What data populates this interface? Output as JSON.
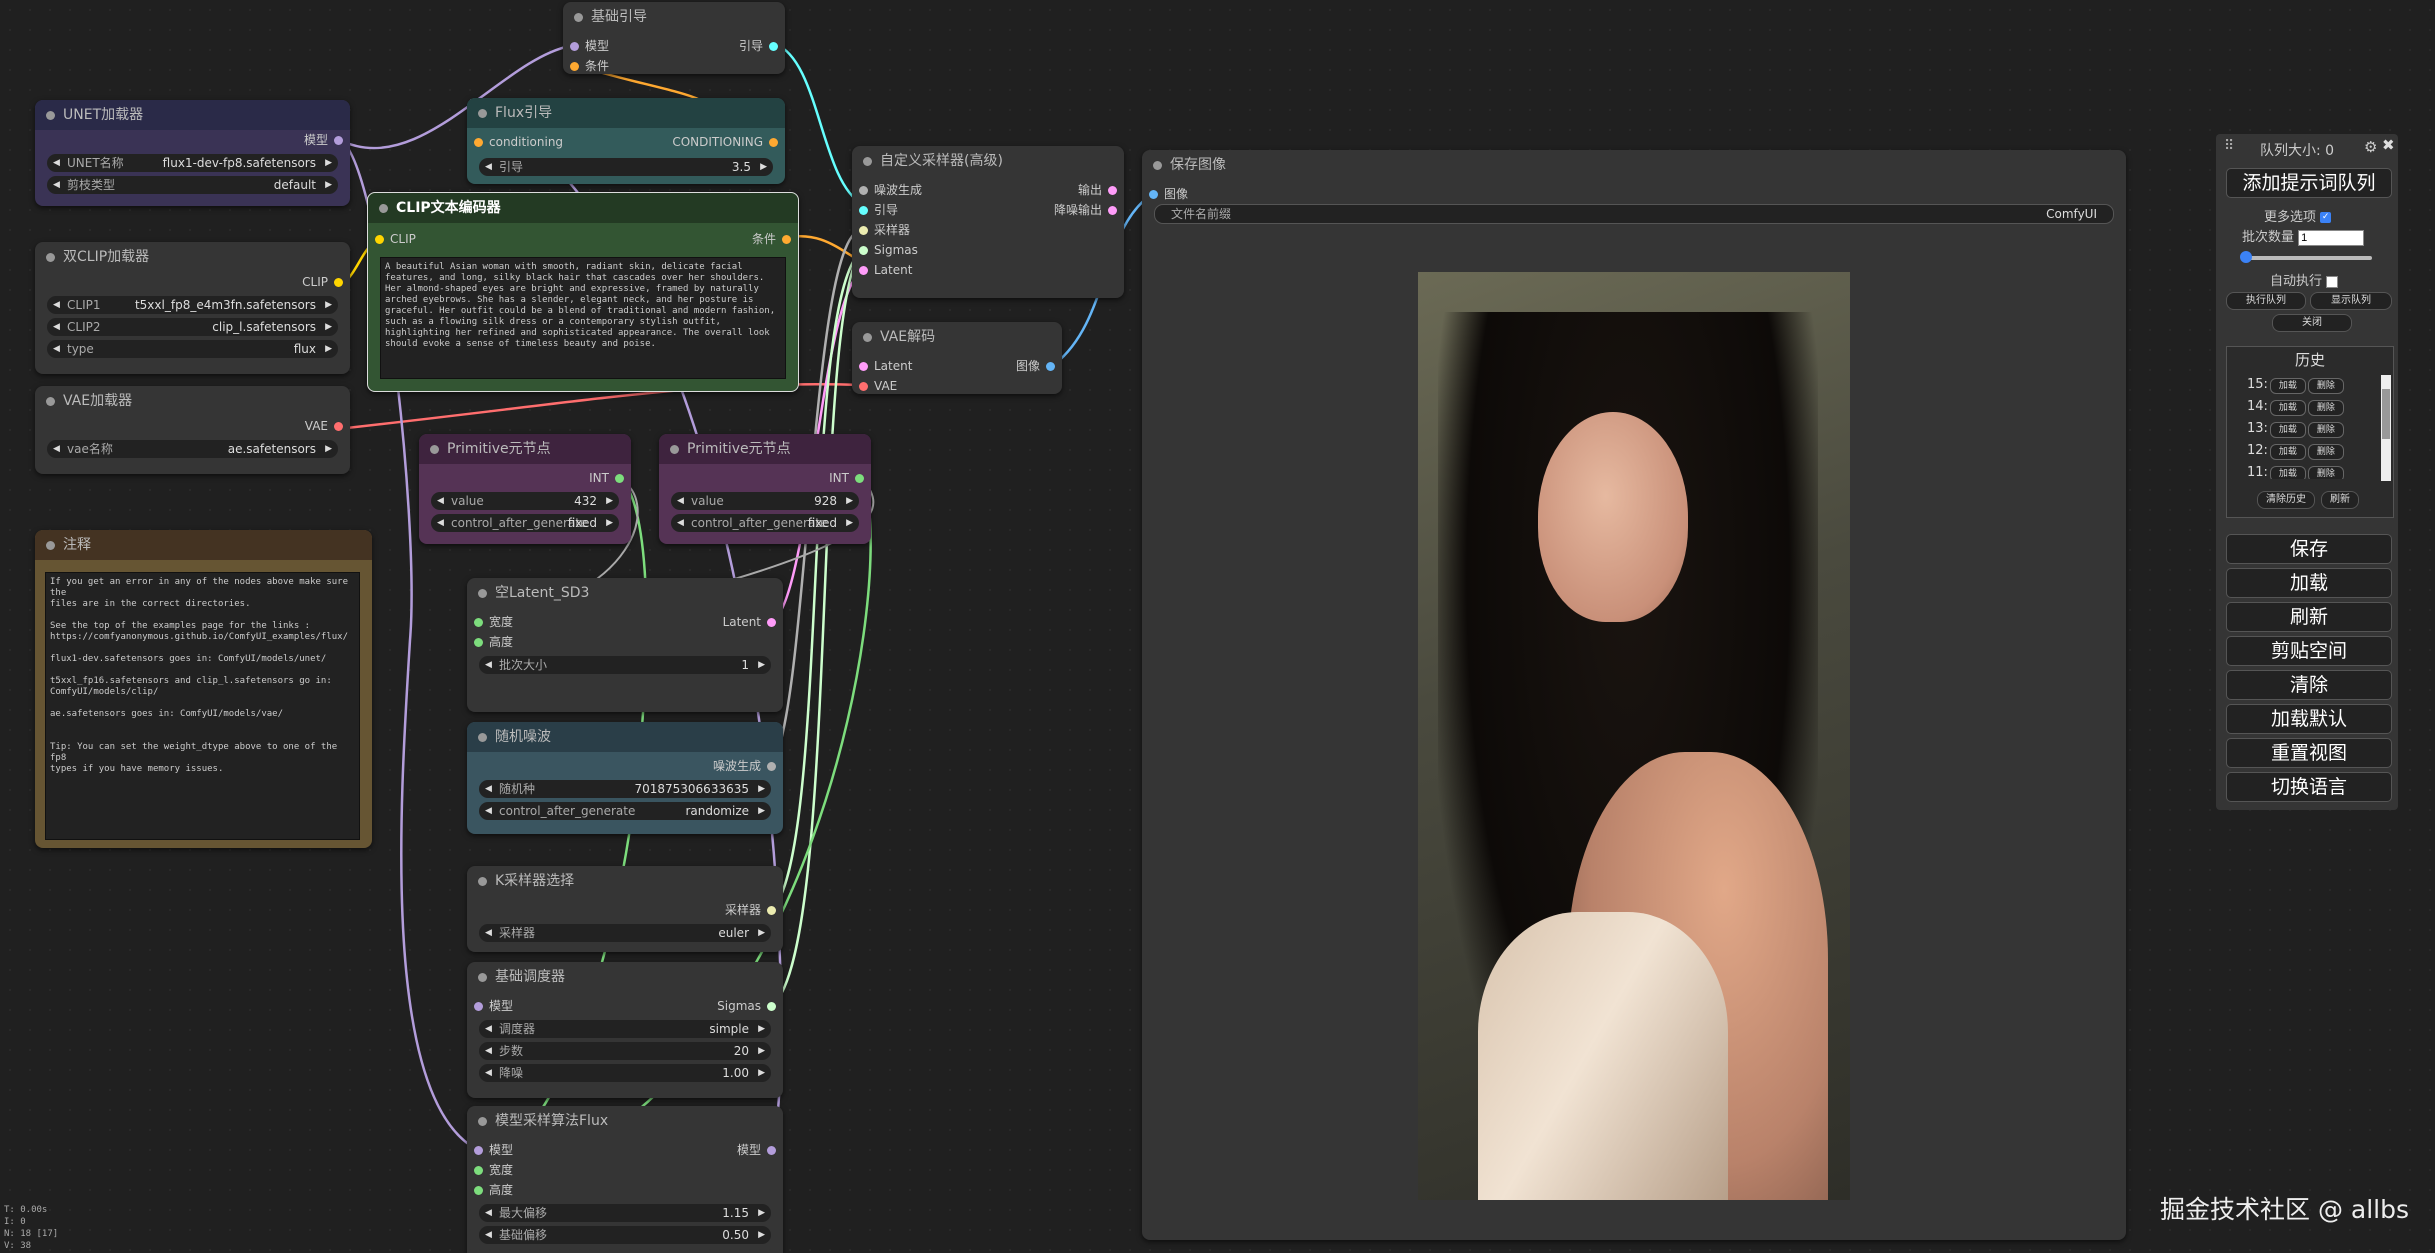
{
  "nodes": {
    "basic_guider": {
      "title": "基础引导",
      "in_model": "模型",
      "in_cond": "条件",
      "out_guider": "引导"
    },
    "unet": {
      "title": "UNET加载器",
      "out_model": "模型",
      "w1_label": "UNET名称",
      "w1_value": "flux1-dev-fp8.safetensors",
      "w2_label": "剪枝类型",
      "w2_value": "default"
    },
    "flux_guidance": {
      "title": "Flux引导",
      "in_cond": "conditioning",
      "out_cond": "CONDITIONING",
      "w_label": "引导",
      "w_value": "3.5"
    },
    "sampler_custom": {
      "title": "自定义采样器(高级)",
      "in_noise": "噪波生成",
      "in_guider": "引导",
      "in_sampler": "采样器",
      "in_sigmas": "Sigmas",
      "in_latent": "Latent",
      "out_output": "输出",
      "out_denoised": "降噪输出"
    },
    "save_image": {
      "title": "保存图像",
      "in_images": "图像",
      "w_label": "文件名前缀",
      "w_value": "ComfyUI"
    },
    "dual_clip": {
      "title": "双CLIP加载器",
      "out_clip": "CLIP",
      "w1_label": "CLIP1",
      "w1_value": "t5xxl_fp8_e4m3fn.safetensors",
      "w2_label": "CLIP2",
      "w2_value": "clip_l.safetensors",
      "w3_label": "type",
      "w3_value": "flux"
    },
    "clip_text": {
      "title": "CLIP文本编码器",
      "in_clip": "CLIP",
      "out_cond": "条件",
      "text": "A beautiful Asian woman with smooth, radiant skin, delicate facial features, and long, silky black hair that cascades over her shoulders. Her almond-shaped eyes are bright and expressive, framed by naturally arched eyebrows. She has a slender, elegant neck, and her posture is graceful. Her outfit could be a blend of traditional and modern fashion, such as a flowing silk dress or a contemporary stylish outfit, highlighting her refined and sophisticated appearance. The overall look should evoke a sense of timeless beauty and poise."
    },
    "vae_decode": {
      "title": "VAE解码",
      "in_latent": "Latent",
      "in_vae": "VAE",
      "out_image": "图像"
    },
    "vae_loader": {
      "title": "VAE加载器",
      "out_vae": "VAE",
      "w_label": "vae名称",
      "w_value": "ae.safetensors"
    },
    "prim1": {
      "title": "Primitive元节点",
      "out": "INT",
      "w1_label": "value",
      "w1_value": "432",
      "w2_label": "control_after_generate",
      "w2_value": "fixed"
    },
    "prim2": {
      "title": "Primitive元节点",
      "out": "INT",
      "w1_label": "value",
      "w1_value": "928",
      "w2_label": "control_after_generate",
      "w2_value": "fixed"
    },
    "note": {
      "title": "注释",
      "text": "If you get an error in any of the nodes above make sure the\nfiles are in the correct directories.\n\nSee the top of the examples page for the links :\nhttps://comfyanonymous.github.io/ComfyUI_examples/flux/\n\nflux1-dev.safetensors goes in: ComfyUI/models/unet/\n\nt5xxl_fp16.safetensors and clip_l.safetensors go in:\nComfyUI/models/clip/\n\nae.safetensors goes in: ComfyUI/models/vae/\n\n\nTip: You can set the weight_dtype above to one of the fp8\ntypes if you have memory issues."
    },
    "empty_latent": {
      "title": "空Latent_SD3",
      "in_width": "宽度",
      "in_height": "高度",
      "out_latent": "Latent",
      "w_label": "批次大小",
      "w_value": "1"
    },
    "random_noise": {
      "title": "随机噪波",
      "out_noise": "噪波生成",
      "w1_label": "随机种",
      "w1_value": "701875306633635",
      "w2_label": "control_after_generate",
      "w2_value": "randomize"
    },
    "ksampler_select": {
      "title": "K采样器选择",
      "out_sampler": "采样器",
      "w_label": "采样器",
      "w_value": "euler"
    },
    "basic_scheduler": {
      "title": "基础调度器",
      "in_model": "模型",
      "out_sigmas": "Sigmas",
      "w1_label": "调度器",
      "w1_value": "simple",
      "w2_label": "步数",
      "w2_value": "20",
      "w3_label": "降噪",
      "w3_value": "1.00"
    },
    "model_sampling": {
      "title": "模型采样算法Flux",
      "in_model": "模型",
      "in_width": "宽度",
      "in_height": "高度",
      "out_model": "模型",
      "w1_label": "最大偏移",
      "w1_value": "1.15",
      "w2_label": "基础偏移",
      "w2_value": "0.50"
    }
  },
  "queue_panel": {
    "queue_size": "队列大小: 0",
    "add_prompt": "添加提示词队列",
    "more_options": "更多选项",
    "batch_count_label": "批次数量",
    "batch_count_value": "1",
    "auto_exec": "自动执行",
    "exec_queue": "执行队列",
    "show_queue": "显示队列",
    "close": "关闭",
    "history_title": "历史",
    "history_items": [
      {
        "index": "15:",
        "load": "加载",
        "delete": "删除"
      },
      {
        "index": "14:",
        "load": "加载",
        "delete": "删除"
      },
      {
        "index": "13:",
        "load": "加载",
        "delete": "删除"
      },
      {
        "index": "12:",
        "load": "加载",
        "delete": "删除"
      },
      {
        "index": "11:",
        "load": "加载",
        "delete": "删除"
      }
    ],
    "clear_history": "清除历史",
    "refresh_small": "刷新",
    "buttons": [
      "保存",
      "加载",
      "刷新",
      "剪贴空间",
      "清除",
      "加载默认",
      "重置视图",
      "切换语言"
    ]
  },
  "stats": {
    "t": "T: 0.00s",
    "i": "I: 0",
    "n": "N: 18 [17]",
    "v": "V: 38"
  },
  "watermark": "掘金技术社区 @ allbs",
  "colors": {
    "clip": "#ffd500",
    "model": "#b39ddb",
    "cond": "#ffa931",
    "latent": "#ff9cf9",
    "vae": "#ff6e6e",
    "image": "#64b5f6",
    "int": "#7ddd7d",
    "noise": "#b0b0b0",
    "guider": "#66ffff",
    "sigmas": "#cdffcd"
  }
}
